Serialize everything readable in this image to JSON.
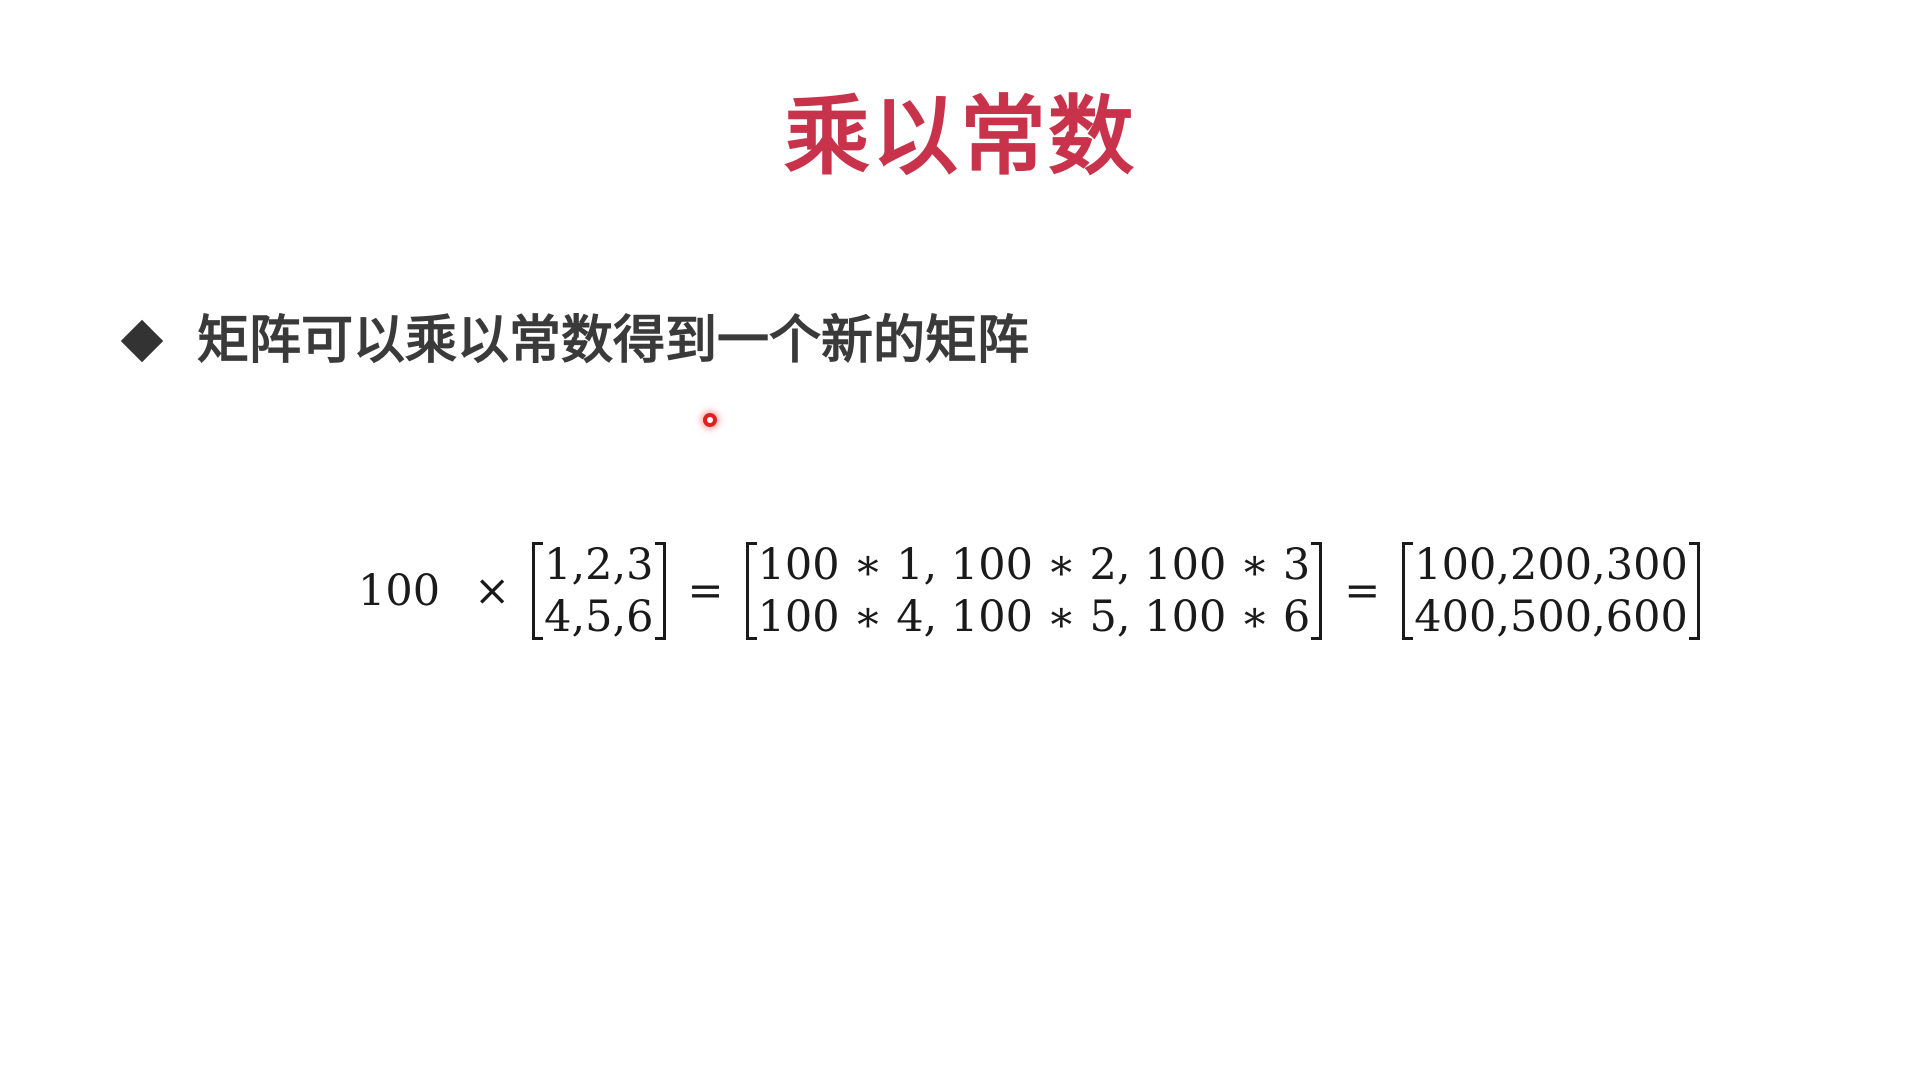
{
  "slide": {
    "title": "乘以常数",
    "bullet": "矩阵可以乘以常数得到一个新的矩阵",
    "equation": {
      "scalar": "100",
      "times": "×",
      "equals": "=",
      "matrix_a": [
        "1,2,3",
        "4,5,6"
      ],
      "matrix_b": [
        "100 ∗ 1, 100 ∗ 2, 100 ∗ 3",
        "100 ∗ 4, 100 ∗ 5, 100 ∗ 6"
      ],
      "matrix_c": [
        "100,200,300",
        "400,500,600"
      ]
    }
  },
  "colors": {
    "title": "#c8324a",
    "bullet_text": "#3a3a3a",
    "math": "#1a1a1a",
    "pointer": "#e02020",
    "background": "#ffffff"
  }
}
